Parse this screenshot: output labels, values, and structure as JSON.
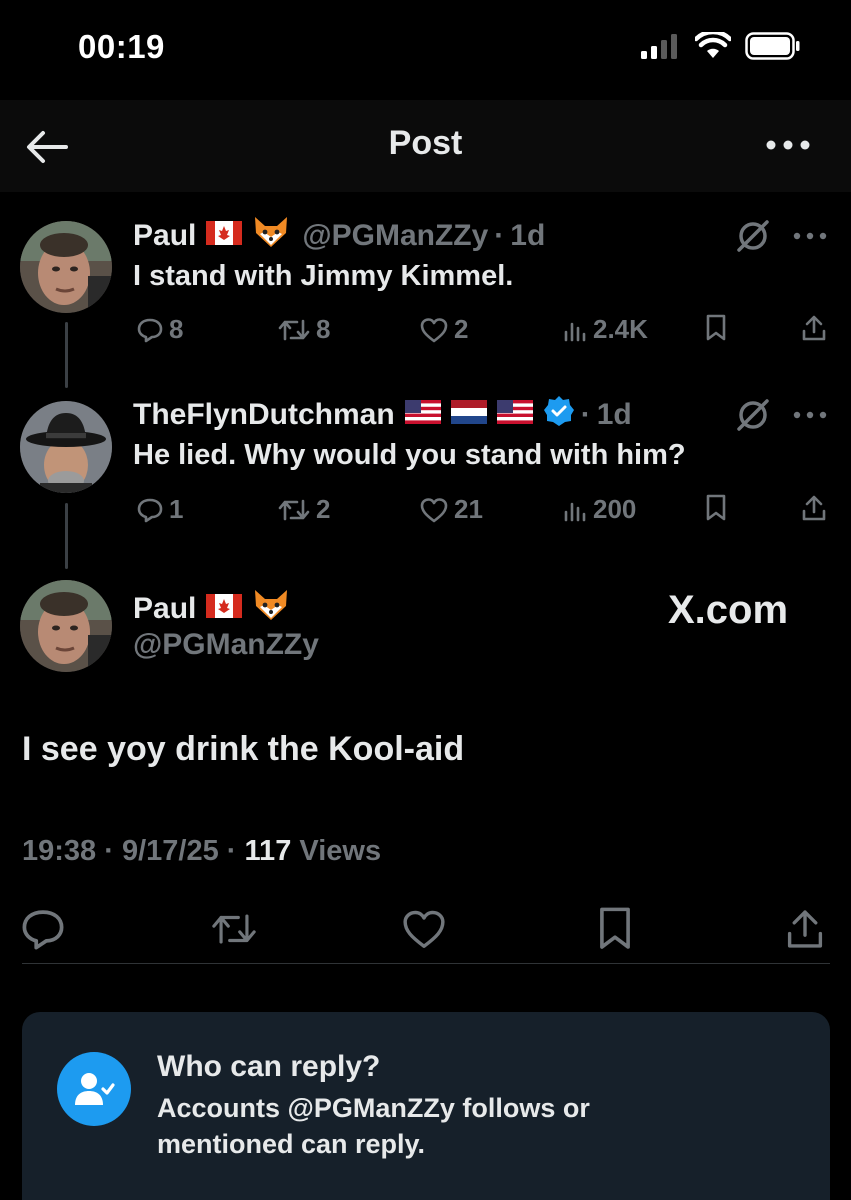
{
  "status_bar": {
    "time": "00:19",
    "icons": [
      "cellular-signal-icon",
      "wifi-icon",
      "battery-icon"
    ]
  },
  "nav": {
    "title": "Post",
    "back_icon": "arrow-left-icon",
    "more_icon": "ellipsis-icon"
  },
  "thread": [
    {
      "name": "Paul",
      "flags": [
        "🇨🇦",
        "🦊"
      ],
      "handle": "@PGManZZy",
      "dot": "·",
      "time": "1d",
      "text": "I stand with Jimmy Kimmel.",
      "replies": "8",
      "reposts": "8",
      "likes": "2",
      "views": "2.4K"
    },
    {
      "name": "TheFlynDutchman",
      "flags": [
        "🇺🇸",
        "🇳🇱",
        "🇺🇸"
      ],
      "verified": true,
      "dot": "·",
      "time": "1d",
      "text": "He lied. Why would you stand with him?",
      "replies": "1",
      "reposts": "2",
      "likes": "21",
      "views": "200"
    }
  ],
  "main_post": {
    "name": "Paul",
    "flags": [
      "🇨🇦",
      "🦊"
    ],
    "handle": "@PGManZZy",
    "watermark": "X.com",
    "text": "I see yoy drink the Kool-aid",
    "time": "19:38",
    "date": "9/17/25",
    "views_count": "117",
    "views_label": "Views",
    "dot": "·"
  },
  "reply_restriction": {
    "title": "Who can reply?",
    "body": "Accounts @PGManZZy follows or mentioned can reply."
  },
  "colors": {
    "background": "#000000",
    "text": "#e7e9ea",
    "muted": "#71767b",
    "accent": "#1d9bf0",
    "card": "#16202a"
  }
}
